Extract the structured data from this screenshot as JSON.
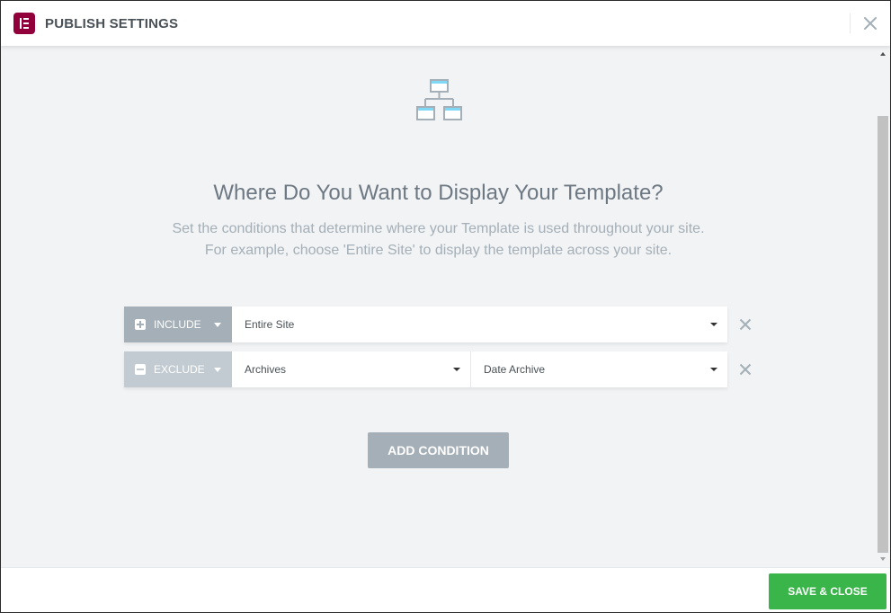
{
  "header": {
    "title": "PUBLISH SETTINGS",
    "logo_icon": "elementor-logo-icon",
    "close_icon": "close-icon"
  },
  "main": {
    "icon": "site-hierarchy-icon",
    "heading": "Where Do You Want to Display Your Template?",
    "description_line1": "Set the conditions that determine where your Template is used throughout your site.",
    "description_line2": "For example, choose 'Entire Site' to display the template across your site.",
    "conditions": [
      {
        "type": "INCLUDE",
        "type_icon": "plus-square-icon",
        "selects": [
          "Entire Site"
        ]
      },
      {
        "type": "EXCLUDE",
        "type_icon": "minus-square-icon",
        "selects": [
          "Archives",
          "Date Archive"
        ]
      }
    ],
    "add_condition_label": "ADD CONDITION"
  },
  "footer": {
    "save_label": "SAVE & CLOSE"
  },
  "colors": {
    "brand": "#92003b",
    "include_bg": "#a4afb7",
    "exclude_bg": "#c2cbd2",
    "save_green": "#39b54a",
    "panel_bg": "#f1f3f5"
  }
}
